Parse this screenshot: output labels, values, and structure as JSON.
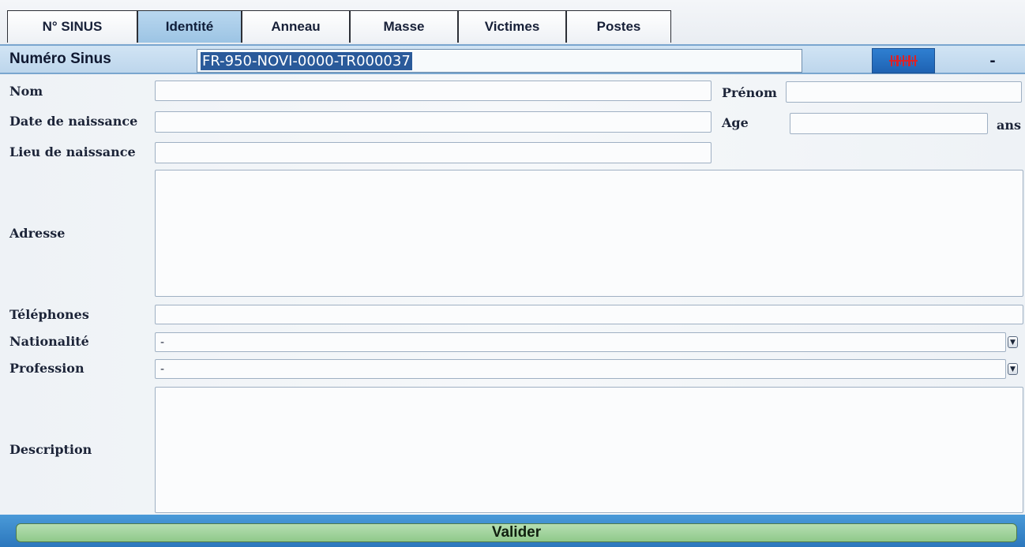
{
  "tabs": [
    {
      "label": "N° SINUS",
      "active": false
    },
    {
      "label": "Identité",
      "active": true
    },
    {
      "label": "Anneau",
      "active": false
    },
    {
      "label": "Masse",
      "active": false
    },
    {
      "label": "Victimes",
      "active": false
    },
    {
      "label": "Postes",
      "active": false
    }
  ],
  "sinus": {
    "label": "Numéro Sinus",
    "value": "FR-950-NOVI-0000-TR000037",
    "barcode_icon": "barcode-icon",
    "dash": "-"
  },
  "form": {
    "nom_label": "Nom",
    "prenom_label": "Prénom",
    "date_label": "Date de naissance",
    "age_label": "Age",
    "age_unit": "ans",
    "lieu_label": "Lieu de naissance",
    "adresse_label": "Adresse",
    "telephones_label": "Téléphones",
    "nationalite_label": "Nationalité",
    "nationalite_value": "-",
    "profession_label": "Profession",
    "profession_value": "-",
    "description_label": "Description"
  },
  "footer": {
    "valider_label": "Valider"
  },
  "colors": {
    "active_tab": "#9cc4e4",
    "sinus_bar": "#bdd6ec",
    "footer": "#2c77bd",
    "valider_button": "#8fc98a",
    "barcode_red": "#d8232a"
  }
}
